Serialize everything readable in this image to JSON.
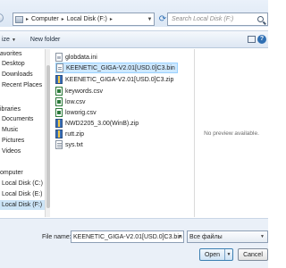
{
  "address_bar": {
    "path": [
      "Computer",
      "Local Disk (F:)"
    ],
    "search_placeholder": "Search Local Disk (F:)"
  },
  "toolbar": {
    "organize_label": "ize",
    "new_folder_label": "New folder"
  },
  "nav": {
    "items": [
      {
        "label": "avorites",
        "kind": "group"
      },
      {
        "label": "Desktop",
        "kind": "item"
      },
      {
        "label": "Downloads",
        "kind": "item"
      },
      {
        "label": "Recent Places",
        "kind": "item"
      },
      {
        "label": "ibraries",
        "kind": "group"
      },
      {
        "label": "Documents",
        "kind": "item"
      },
      {
        "label": "Music",
        "kind": "item"
      },
      {
        "label": "Pictures",
        "kind": "item"
      },
      {
        "label": "Videos",
        "kind": "item"
      },
      {
        "label": "omputer",
        "kind": "group"
      },
      {
        "label": "Local Disk (C:)",
        "kind": "item"
      },
      {
        "label": "Local Disk (E:)",
        "kind": "item"
      },
      {
        "label": "Local Disk (F:)",
        "kind": "item",
        "selected": true
      }
    ]
  },
  "files": [
    {
      "name": "globdata.ini",
      "icon": "ini-file-icon"
    },
    {
      "name": "KEENETIC_GIGA-V2.01[USD.0]C3.bin",
      "icon": "bin-file-icon",
      "selected": true
    },
    {
      "name": "KEENETIC_GIGA-V2.01[USD.0]C3.zip",
      "icon": "zip-file-icon"
    },
    {
      "name": "keywords.csv",
      "icon": "csv-file-icon"
    },
    {
      "name": "low.csv",
      "icon": "csv-file-icon"
    },
    {
      "name": "loworig.csv",
      "icon": "csv-file-icon"
    },
    {
      "name": "NWD2205_3.00(WinB).zip",
      "icon": "zip-file-icon"
    },
    {
      "name": "rutt.zip",
      "icon": "zip-file-icon"
    },
    {
      "name": "sys.txt",
      "icon": "txt-file-icon"
    }
  ],
  "preview": {
    "text": "No preview available."
  },
  "bottom": {
    "file_name_label": "File name:",
    "file_name_value": "KEENETIC_GIGA-V2.01[USD.0]C3.bin",
    "filter_value": "Все файлы",
    "open_label": "Open",
    "cancel_label": "Cancel"
  },
  "colors": {
    "selection": "#cde8ff",
    "accent": "#2f6fb3",
    "chrome": "#eaf0f8"
  }
}
